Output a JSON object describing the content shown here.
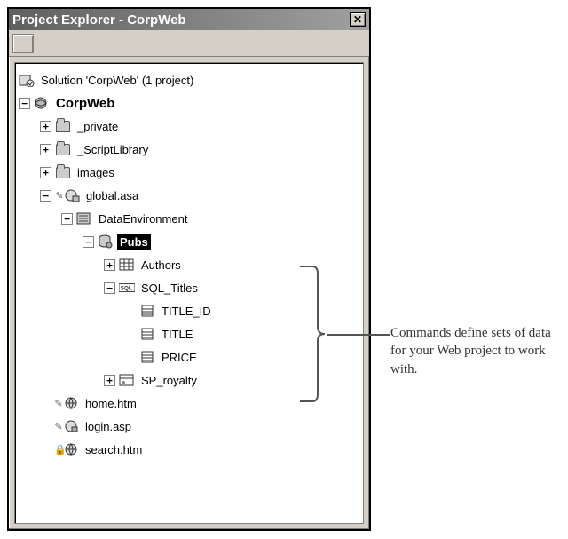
{
  "window": {
    "title": "Project Explorer - CorpWeb"
  },
  "tree": {
    "solution": "Solution 'CorpWeb' (1 project)",
    "project": "CorpWeb",
    "private": "_private",
    "scriptlib": "_ScriptLibrary",
    "images": "images",
    "globalasa": "global.asa",
    "dataenv": "DataEnvironment",
    "pubs": "Pubs",
    "authors": "Authors",
    "sqltitles": "SQL_Titles",
    "titleid": "TITLE_ID",
    "title": "TITLE",
    "price": "PRICE",
    "sproyalty": "SP_royalty",
    "home": "home.htm",
    "login": "login.asp",
    "search": "search.htm"
  },
  "callout": "Commands define sets of data for your Web project to work with."
}
